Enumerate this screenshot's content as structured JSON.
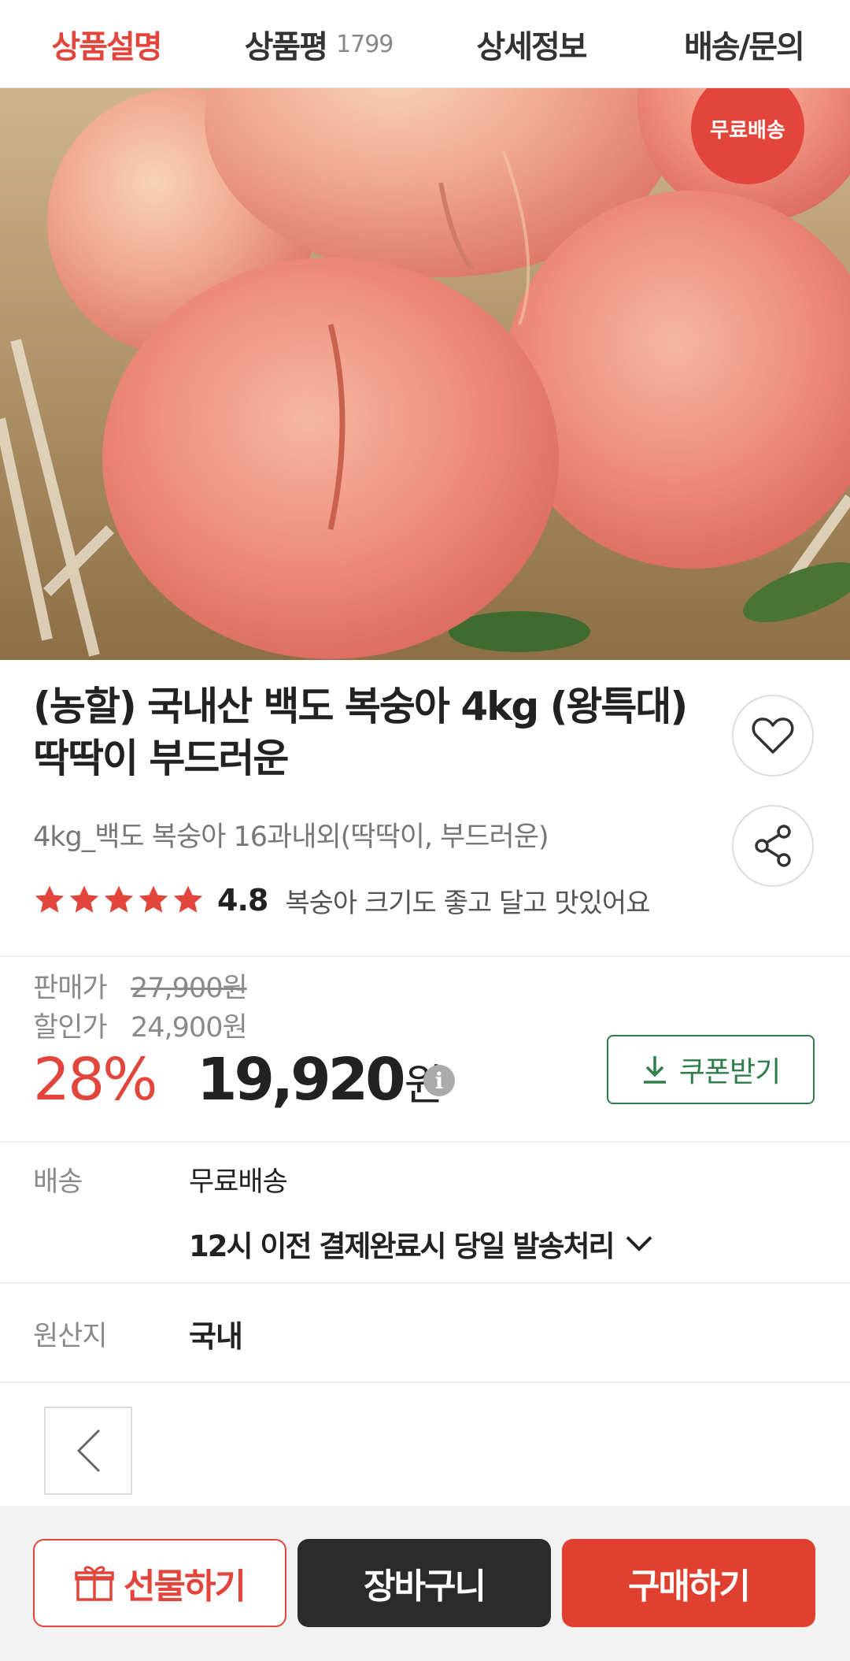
{
  "tabs": [
    {
      "label": "상품설명",
      "active": true
    },
    {
      "label": "상품평",
      "count": "1799"
    },
    {
      "label": "상세정보"
    },
    {
      "label": "배송/문의"
    }
  ],
  "hero": {
    "badge": "무료배송"
  },
  "product": {
    "title_line1": "(농할) 국내산 백도 복숭아 4kg (왕특대)",
    "title_line2": "딱딱이 부드러운",
    "option": "4kg_백도 복숭아 16과내외(딱딱이, 부드러운)",
    "rating": "4.8",
    "stars": 5,
    "review_snippet": "복숭아 크기도 좋고 달고 맛있어요"
  },
  "price": {
    "sale_label": "판매가",
    "sale_value": "27,900원",
    "discount_label": "할인가",
    "discount_value": "24,900원",
    "discount_rate": "28%",
    "final_value": "19,920",
    "final_unit": "원",
    "info_icon": "i",
    "coupon_label": "쿠폰받기"
  },
  "delivery": {
    "label": "배송",
    "value": "무료배송",
    "detail": "12시 이전 결제완료시 당일 발송처리"
  },
  "origin": {
    "label": "원산지",
    "value": "국내"
  },
  "bottom": {
    "gift": "선물하기",
    "cart": "장바구니",
    "buy": "구매하기"
  },
  "colors": {
    "accent": "#e2453b",
    "coupon_green": "#2e7d4a",
    "cart_dark": "#2b2b2b",
    "buy_red": "#e0402f"
  }
}
